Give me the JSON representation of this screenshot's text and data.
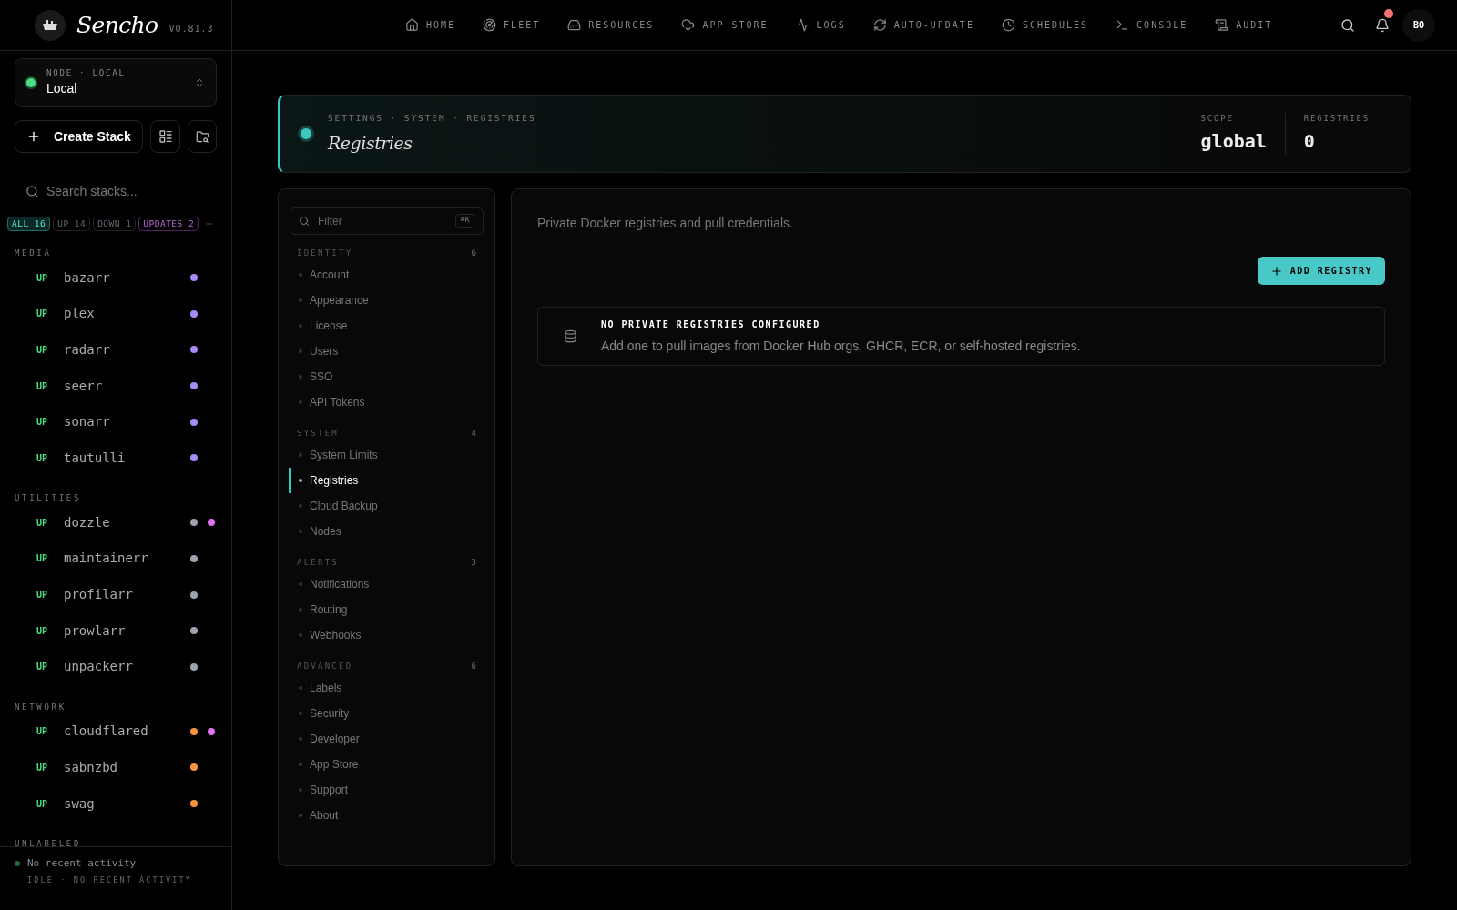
{
  "brand": {
    "name": "Sencho",
    "version": "V0.81.3"
  },
  "node": {
    "label": "NODE · LOCAL",
    "name": "Local",
    "online": true
  },
  "create_button": "Create Stack",
  "search": {
    "placeholder": "Search stacks..."
  },
  "filters": [
    {
      "label": "ALL",
      "count": "16",
      "kind": "all",
      "selected": true
    },
    {
      "label": "UP",
      "count": "14",
      "kind": "up",
      "selected": false
    },
    {
      "label": "DOWN",
      "count": "1",
      "kind": "down",
      "selected": false
    },
    {
      "label": "UPDATES",
      "count": "2",
      "kind": "updates",
      "selected": false
    }
  ],
  "stack_groups": [
    {
      "title": "MEDIA",
      "stacks": [
        {
          "status": "UP",
          "name": "bazarr",
          "color": "#a78bfa",
          "update": false
        },
        {
          "status": "UP",
          "name": "plex",
          "color": "#a78bfa",
          "update": false
        },
        {
          "status": "UP",
          "name": "radarr",
          "color": "#a78bfa",
          "update": false
        },
        {
          "status": "UP",
          "name": "seerr",
          "color": "#a78bfa",
          "update": false
        },
        {
          "status": "UP",
          "name": "sonarr",
          "color": "#a78bfa",
          "update": false
        },
        {
          "status": "UP",
          "name": "tautulli",
          "color": "#a78bfa",
          "update": false
        }
      ]
    },
    {
      "title": "UTILITIES",
      "stacks": [
        {
          "status": "UP",
          "name": "dozzle",
          "color": "#9ca3af",
          "update": true
        },
        {
          "status": "UP",
          "name": "maintainerr",
          "color": "#9ca3af",
          "update": false
        },
        {
          "status": "UP",
          "name": "profilarr",
          "color": "#9ca3af",
          "update": false
        },
        {
          "status": "UP",
          "name": "prowlarr",
          "color": "#9ca3af",
          "update": false
        },
        {
          "status": "UP",
          "name": "unpackerr",
          "color": "#9ca3af",
          "update": false
        }
      ]
    },
    {
      "title": "NETWORK",
      "stacks": [
        {
          "status": "UP",
          "name": "cloudflared",
          "color": "#fb923c",
          "update": true
        },
        {
          "status": "UP",
          "name": "sabnzbd",
          "color": "#fb923c",
          "update": false
        },
        {
          "status": "UP",
          "name": "swag",
          "color": "#fb923c",
          "update": false
        }
      ]
    },
    {
      "title": "UNLABELED"
    }
  ],
  "activity": {
    "title": "No recent activity",
    "subtitle": "IDLE · NO RECENT ACTIVITY"
  },
  "nav": [
    {
      "label": "HOME"
    },
    {
      "label": "FLEET"
    },
    {
      "label": "RESOURCES"
    },
    {
      "label": "APP STORE"
    },
    {
      "label": "LOGS"
    },
    {
      "label": "AUTO-UPDATE"
    },
    {
      "label": "SCHEDULES"
    },
    {
      "label": "CONSOLE"
    },
    {
      "label": "AUDIT"
    }
  ],
  "notifications_unread": true,
  "avatar": "BO",
  "header": {
    "breadcrumb": "SETTINGS · SYSTEM · REGISTRIES",
    "title": "Registries",
    "stats": [
      {
        "label": "SCOPE",
        "value": "global"
      },
      {
        "label": "REGISTRIES",
        "value": "0"
      }
    ]
  },
  "settings_filter": {
    "placeholder": "Filter",
    "shortcut": "⌘K"
  },
  "settings_groups": [
    {
      "title": "IDENTITY",
      "count": "6",
      "items": [
        {
          "label": "Account",
          "selected": false
        },
        {
          "label": "Appearance",
          "selected": false
        },
        {
          "label": "License",
          "selected": false
        },
        {
          "label": "Users",
          "selected": false
        },
        {
          "label": "SSO",
          "selected": false
        },
        {
          "label": "API Tokens",
          "selected": false
        }
      ]
    },
    {
      "title": "SYSTEM",
      "count": "4",
      "items": [
        {
          "label": "System Limits",
          "selected": false
        },
        {
          "label": "Registries",
          "selected": true
        },
        {
          "label": "Cloud Backup",
          "selected": false
        },
        {
          "label": "Nodes",
          "selected": false
        }
      ]
    },
    {
      "title": "ALERTS",
      "count": "3",
      "items": [
        {
          "label": "Notifications",
          "selected": false
        },
        {
          "label": "Routing",
          "selected": false
        },
        {
          "label": "Webhooks",
          "selected": false
        }
      ]
    },
    {
      "title": "ADVANCED",
      "count": "6",
      "items": [
        {
          "label": "Labels",
          "selected": false
        },
        {
          "label": "Security",
          "selected": false
        },
        {
          "label": "Developer",
          "selected": false
        },
        {
          "label": "App Store",
          "selected": false
        },
        {
          "label": "Support",
          "selected": false
        },
        {
          "label": "About",
          "selected": false
        }
      ]
    }
  ],
  "panel": {
    "description": "Private Docker registries and pull credentials.",
    "add_button": "ADD REGISTRY",
    "empty_title": "NO PRIVATE REGISTRIES CONFIGURED",
    "empty_text": "Add one to pull images from Docker Hub orgs, GHCR, ECR, or self-hosted registries."
  }
}
